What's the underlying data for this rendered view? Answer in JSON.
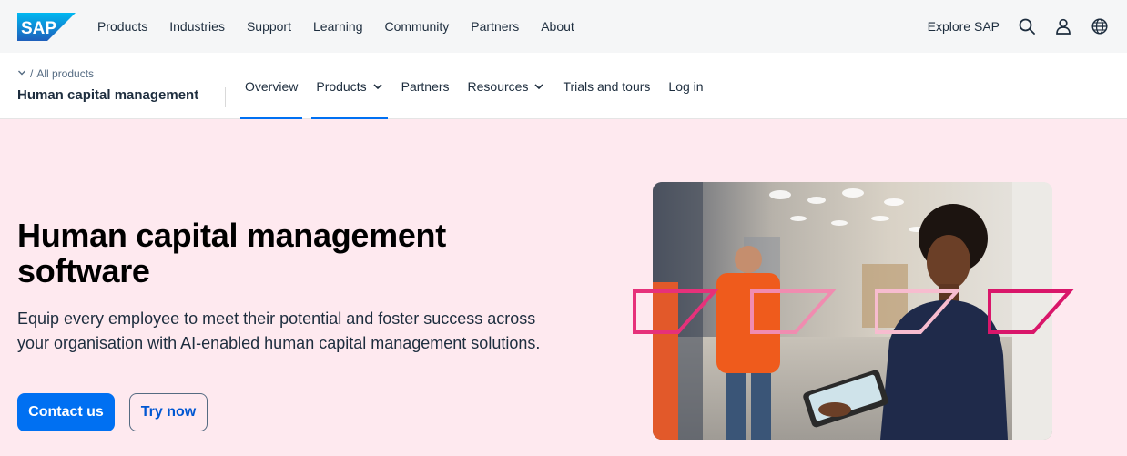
{
  "brand": {
    "logo_text": "SAP",
    "accent": "#0070f2",
    "hero_bg": "#fee9ef"
  },
  "topnav": {
    "items": [
      "Products",
      "Industries",
      "Support",
      "Learning",
      "Community",
      "Partners",
      "About"
    ],
    "explore_label": "Explore SAP",
    "icons": [
      "search-icon",
      "user-icon",
      "globe-icon"
    ]
  },
  "subnav": {
    "breadcrumb_sep": "/",
    "breadcrumb_link": "All products",
    "section_title": "Human capital management",
    "tabs": [
      {
        "label": "Overview",
        "active": true,
        "dropdown": false
      },
      {
        "label": "Products",
        "active": false,
        "dropdown": true
      },
      {
        "label": "Partners",
        "active": false,
        "dropdown": false
      },
      {
        "label": "Resources",
        "active": false,
        "dropdown": true
      },
      {
        "label": "Trials and tours",
        "active": false,
        "dropdown": false
      },
      {
        "label": "Log in",
        "active": false,
        "dropdown": false
      }
    ]
  },
  "hero": {
    "headline": "Human capital management software",
    "description": "Equip every employee to meet their potential and foster success across your organisation with AI-enabled human capital management solutions.",
    "primary_cta": "Contact us",
    "secondary_cta": "Try now"
  }
}
